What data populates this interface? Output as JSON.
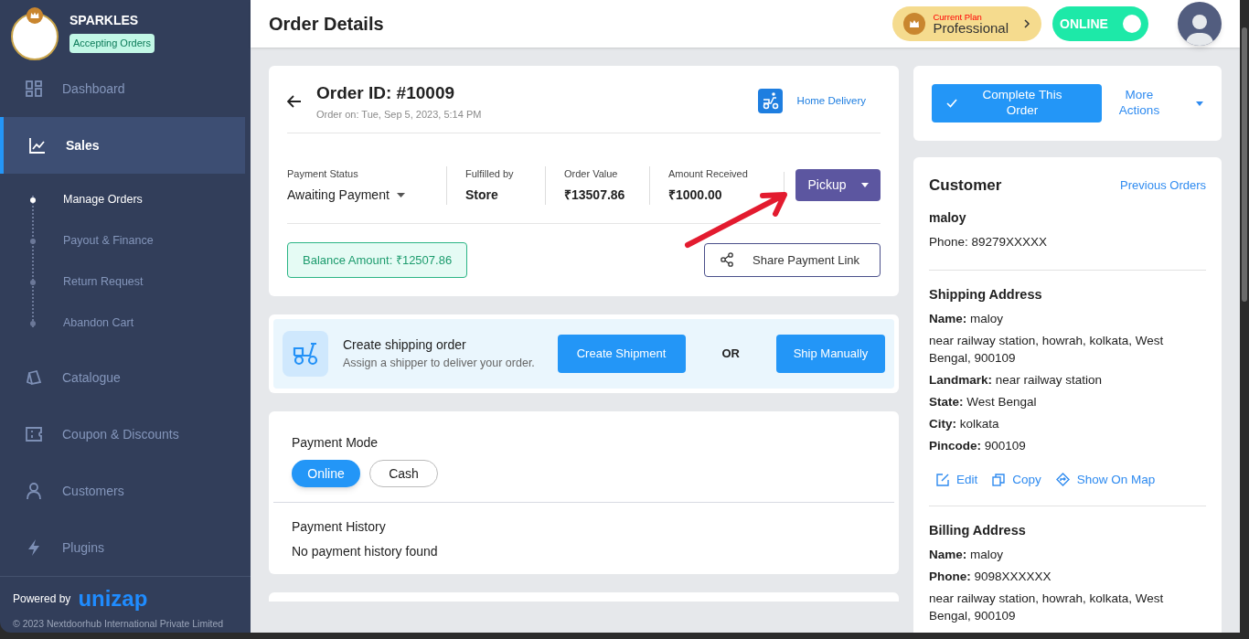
{
  "sidebar": {
    "store_name": "SPARKLES",
    "store_status": "Accepting Orders",
    "nav": [
      {
        "label": "Dashboard",
        "selected": false
      },
      {
        "label": "Sales",
        "selected": true,
        "children": [
          {
            "label": "Manage Orders",
            "selected": true
          },
          {
            "label": "Payout & Finance",
            "selected": false
          },
          {
            "label": "Return Request",
            "selected": false
          },
          {
            "label": "Abandon Cart",
            "selected": false
          }
        ]
      },
      {
        "label": "Catalogue",
        "selected": false
      },
      {
        "label": "Coupon & Discounts",
        "selected": false
      },
      {
        "label": "Customers",
        "selected": false
      },
      {
        "label": "Plugins",
        "selected": false
      }
    ],
    "powered_by": "Powered by",
    "brand": "unizap",
    "copyright": "© 2023 Nextdoorhub International Private Limited"
  },
  "header": {
    "title": "Order Details",
    "plan_label": "Current Plan",
    "plan_name": "Professional",
    "status_label": "ONLINE",
    "status_on": true
  },
  "order": {
    "id": "Order ID: #10009",
    "date": "Order on: Tue, Sep 5, 2023, 5:14 PM",
    "delivery": "Home Delivery",
    "stats": [
      {
        "label": "Payment Status",
        "value": "Awaiting Payment",
        "kind": "dropdown"
      },
      {
        "label": "Fulfilled by",
        "value": "Store",
        "kind": "text"
      },
      {
        "label": "Order Value",
        "value": "₹13507.86",
        "kind": "text"
      },
      {
        "label": "Amount Received",
        "value": "₹1000.00",
        "kind": "text"
      }
    ],
    "status_button": "Pickup",
    "balance": "Balance Amount: ₹12507.86",
    "share": "Share Payment Link"
  },
  "shipping": {
    "title": "Create shipping order",
    "subtitle": "Assign a shipper to deliver your order.",
    "primary": "Create Shipment",
    "or": "OR",
    "secondary": "Ship Manually"
  },
  "payment": {
    "mode_title": "Payment Mode",
    "modes": [
      {
        "label": "Online",
        "selected": true
      },
      {
        "label": "Cash",
        "selected": false
      }
    ],
    "history_title": "Payment History",
    "history_text": "No payment history found"
  },
  "actions": {
    "complete": "Complete This Order",
    "more": "More Actions"
  },
  "customer": {
    "title": "Customer",
    "link": "Previous Orders",
    "name": "maloy",
    "phone": "Phone: 89279XXXXX",
    "shipping_title": "Shipping Address",
    "shipping_lines": [
      "**Name:** maloy",
      "near railway station, howrah, kolkata, West Bengal, 900109",
      "**Landmark:** near railway station",
      "**State:** West Bengal",
      "**City:** kolkata",
      "**Pincode:** 900109"
    ],
    "address_actions": [
      "Edit",
      "Copy",
      "Show On Map"
    ],
    "billing_title": "Billing Address",
    "billing_lines": [
      "**Name:** maloy",
      "**Phone:** 9098XXXXXX",
      "near railway station, howrah, kolkata, West Bengal, 900109"
    ]
  }
}
